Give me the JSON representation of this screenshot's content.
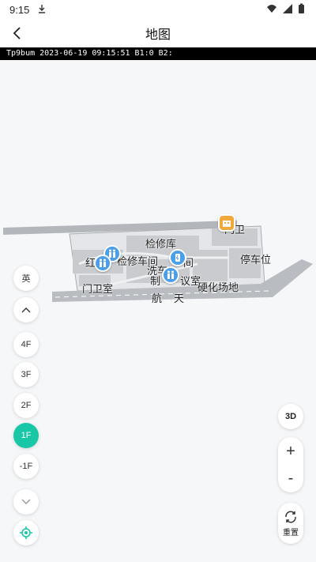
{
  "status": {
    "time": "9:15"
  },
  "nav": {
    "title": "地图"
  },
  "info_strip": {
    "text": "Tp9bum 2023-06-19 09:15:51 B1:0    B2:"
  },
  "map": {
    "labels": {
      "inspection_depot": "检修库",
      "guard_top": "门卫",
      "parking": "停车位",
      "red_label": "红",
      "workshop": "检修车间",
      "wash": "洗车",
      "room": "间",
      "hall": "制",
      "meeting": "议室",
      "hard_field": "硬化场地",
      "gate_room": "门卫室",
      "hang": "航",
      "tian": "天"
    },
    "colors": {
      "building_fill": "#c9cbcf",
      "road_fill": "#b9bcc1",
      "poi_blue": "#4a9fe8",
      "poi_orange": "#f0a93a"
    }
  },
  "left_controls": {
    "lang": "英",
    "floors": [
      "4F",
      "3F",
      "2F",
      "1F",
      "-1F"
    ],
    "active_floor": "1F"
  },
  "right_controls": {
    "mode_3d": "3D",
    "zoom_in": "+",
    "zoom_out": "-",
    "reset_label": "重置"
  }
}
